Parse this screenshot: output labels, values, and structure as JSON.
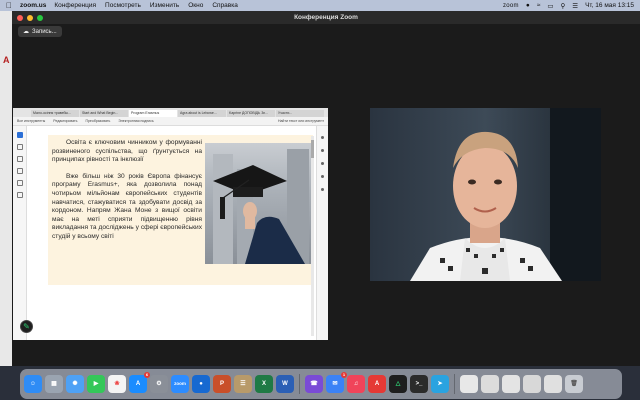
{
  "menubar": {
    "app_name": "zoom.us",
    "items": [
      "Конференция",
      "Посмотреть",
      "Изменить",
      "Окно",
      "Справка"
    ],
    "zoom_label": "zoom",
    "datetime": "Чт, 16 мая  13:15"
  },
  "window": {
    "title": "Конференция Zoom",
    "recording_label": "Запись..."
  },
  "shared_screen": {
    "tabs": [
      "Мало-осіння травебы...",
      "Start and What Begin...",
      "Program Erasmus",
      "Agra about is Lebowe...",
      "Kaprine ДОПОВІДЬ 3n...",
      "Участи..."
    ],
    "toolbar": [
      "Все инструменты",
      "Редактировать",
      "Преобразовать",
      "Электронная подпись"
    ],
    "toolbar_right": "Найти текст или инструмент",
    "paragraphs": [
      "Освіта є ключовим чинником у формуванні розвиненого суспільства, що ґрунтується на принципах рівності та інклюзії",
      "Вже більш ніж 30 років Європа фінансує програму Erasmus+, яка дозволила понад чотирьом мільйонам європейських студентів навчатися, стажуватися та здобувати досвід за кордоном. Напрям Жана Моне з вищої освіти має на меті сприяти підвищенню рівня викладання та досліджень у сфері європейських студій у всьому світі"
    ]
  },
  "colors": {
    "menubar": "#b8c3d8",
    "page_bg": "#fdf3df",
    "accent": "#2b6fd6"
  },
  "dock": {
    "badges": {
      "appstore": "6",
      "mail": "1"
    }
  }
}
